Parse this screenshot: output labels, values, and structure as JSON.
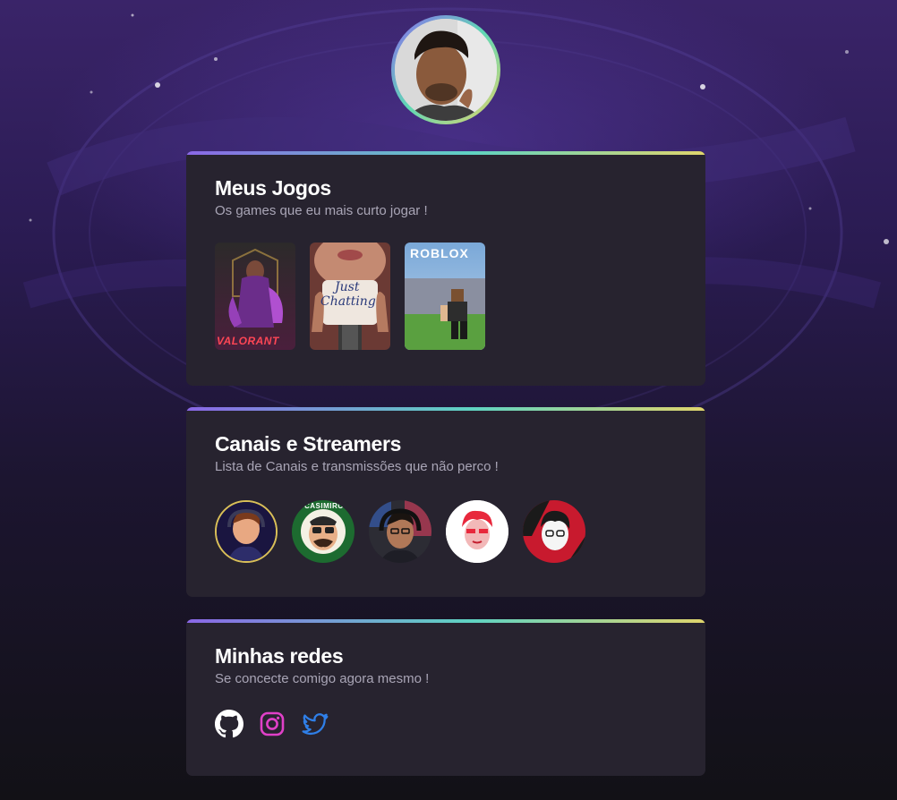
{
  "profile": {
    "avatar_alt": "profile-photo"
  },
  "games_section": {
    "title": "Meus Jogos",
    "subtitle": "Os games que eu mais curto jogar !",
    "games": [
      {
        "label": "VALORANT"
      },
      {
        "label_line1": "Just",
        "label_line2": "Chatting"
      },
      {
        "label": "ROBLOX"
      }
    ]
  },
  "channels_section": {
    "title": "Canais e Streamers",
    "subtitle": "Lista de Canais e transmissões que não perco !",
    "channels": [
      {
        "ring_color": "#d9bf58"
      },
      {
        "text": "CASIMIRO"
      },
      {
        "ring_color": "#2b2b2b"
      },
      {
        "ring_color": "#ffffff"
      },
      {
        "ring_color": "#c81a2e"
      }
    ]
  },
  "social_section": {
    "title": "Minhas redes",
    "subtitle": "Se concecte comigo agora mesmo !",
    "links": [
      {
        "icon": "github-icon",
        "color": "#ffffff"
      },
      {
        "icon": "instagram-icon",
        "color": "#e040c8"
      },
      {
        "icon": "twitter-icon",
        "color": "#2f7fe8"
      }
    ]
  }
}
